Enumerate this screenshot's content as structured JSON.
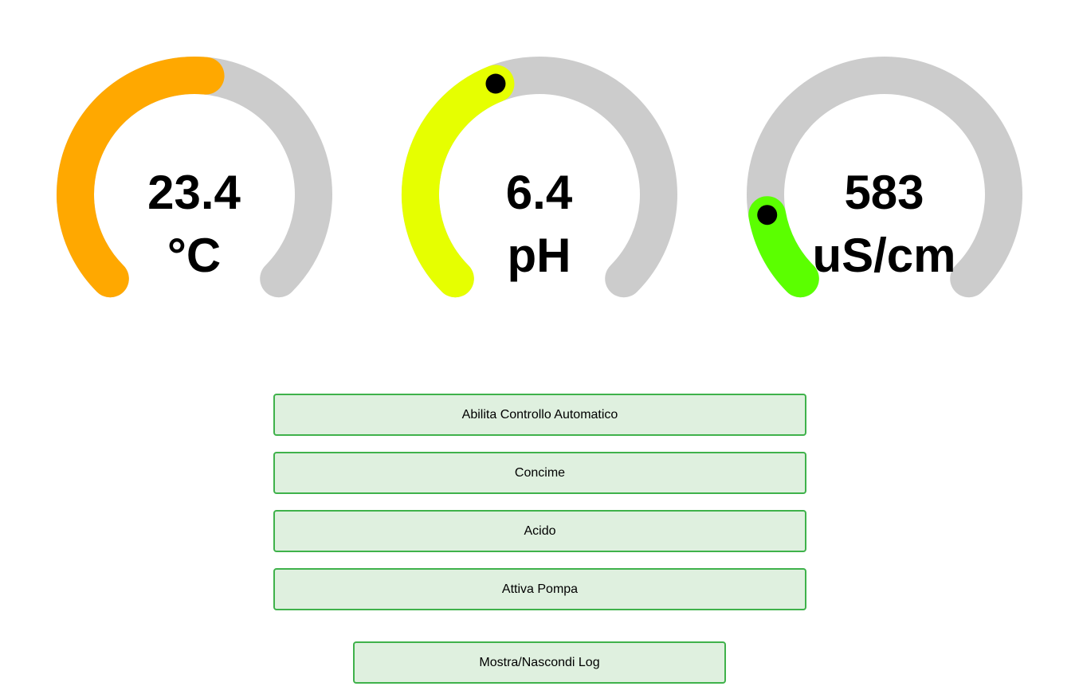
{
  "gauges": [
    {
      "value": "23.4",
      "unit": "°C",
      "fraction": 0.52,
      "color": "#ffa800",
      "pointer": false
    },
    {
      "value": "6.4",
      "unit": "pH",
      "fraction": 0.42,
      "color": "#e6ff00",
      "pointer": true
    },
    {
      "value": "583",
      "unit": "uS/cm",
      "fraction": 0.13,
      "color": "#5bff00",
      "pointer": true
    }
  ],
  "track_color": "#cccccc",
  "controls": {
    "auto_label": "Abilita Controllo Automatico",
    "fertilizer_label": "Concime",
    "acid_label": "Acido",
    "pump_label": "Attiva Pompa",
    "log_label": "Mostra/Nascondi Log"
  },
  "button_colors": {
    "background": "#dff0df",
    "border": "#3fb24b"
  }
}
